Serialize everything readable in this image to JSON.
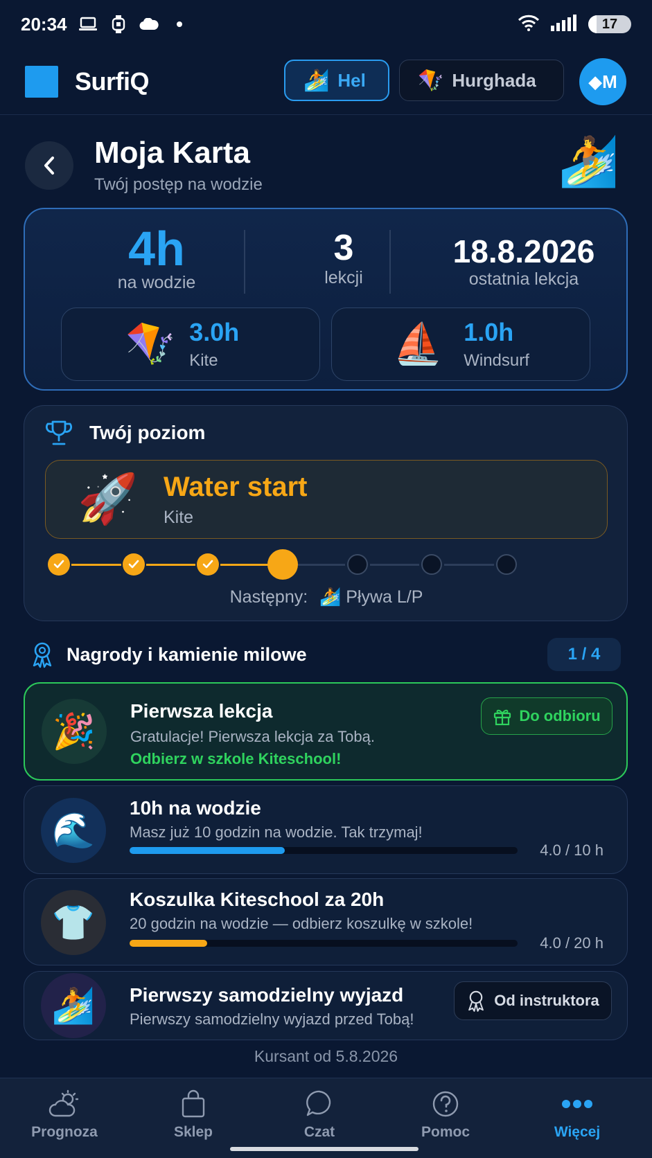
{
  "status_bar": {
    "time": "20:34",
    "battery": "17"
  },
  "header": {
    "app_name": "SurfiQ",
    "locations": [
      {
        "label": "Hel",
        "icon": "surfer-emoji",
        "active": true
      },
      {
        "label": "Hurghada",
        "icon": "kite-emoji",
        "active": false
      }
    ],
    "avatar_initials": "◆M"
  },
  "page": {
    "title": "Moja Karta",
    "subtitle": "Twój postęp na wodzie",
    "title_emoji": "🏄"
  },
  "stats": {
    "hours": {
      "value": "4h",
      "label": "na wodzie"
    },
    "lessons": {
      "value": "3",
      "label": "lekcji"
    },
    "last_lesson": {
      "value": "18.8.2026",
      "label": "ostatnia lekcja"
    },
    "sports": [
      {
        "emoji": "🪁",
        "value": "3.0h",
        "name": "Kite"
      },
      {
        "emoji": "⛵",
        "value": "1.0h",
        "name": "Windsurf"
      }
    ]
  },
  "level": {
    "heading": "Twój poziom",
    "current": {
      "emoji": "🚀",
      "name": "Water start",
      "sport": "Kite"
    },
    "steps_total": 7,
    "steps_done": 3,
    "current_step": 4,
    "next_label": "Następny:",
    "next_emoji": "🏄",
    "next_value": "Pływa L/P"
  },
  "rewards": {
    "heading": "Nagrody i kamienie milowe",
    "count": "1 / 4",
    "items": [
      {
        "emoji": "🎉",
        "title": "Pierwsza lekcja",
        "desc": "Gratulacje! Pierwsza lekcja za Tobą.",
        "note": "Odbierz w szkole Kiteschool!",
        "button": "Do odbioru"
      },
      {
        "emoji": "🌊",
        "title": "10h na wodzie",
        "desc": "Masz już 10 godzin na wodzie. Tak trzymaj!",
        "progress": 0.4,
        "progress_text": "4.0 / 10 h",
        "color": "#1e9bef"
      },
      {
        "emoji": "👕",
        "title": "Koszulka Kiteschool za 20h",
        "desc": "20 godzin na wodzie — odbierz koszulkę w szkole!",
        "progress": 0.2,
        "progress_text": "4.0 / 20 h",
        "color": "#f7a716"
      },
      {
        "emoji": "🏄",
        "title": "Pierwszy samodzielny wyjazd",
        "desc": "Pierwszy samodzielny wyjazd przed Tobą!",
        "button": "Od instruktora"
      }
    ],
    "member_since": "Kursant od 5.8.2026"
  },
  "nav": [
    {
      "label": "Prognoza",
      "icon": "weather-icon",
      "active": false
    },
    {
      "label": "Sklep",
      "icon": "shopping-bag-icon",
      "active": false
    },
    {
      "label": "Czat",
      "icon": "chat-icon",
      "active": false
    },
    {
      "label": "Pomoc",
      "icon": "help-icon",
      "active": false
    },
    {
      "label": "Więcej",
      "icon": "more-icon",
      "active": true
    }
  ],
  "colors": {
    "accent": "#1e9bef",
    "level": "#f7a716",
    "success": "#2fd35e",
    "background": "#0a1832"
  }
}
